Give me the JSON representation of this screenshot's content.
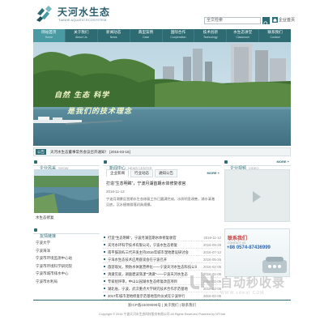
{
  "header": {
    "logo_cn": "天河水生态",
    "logo_en": "TIANHE AQUATIC ECOSYSTEM",
    "search_placeholder": "全文检索",
    "home_link": "企业首页"
  },
  "nav": [
    {
      "cn": "网站首页",
      "en": "Home",
      "active": true
    },
    {
      "cn": "关于我们",
      "en": "About Us"
    },
    {
      "cn": "新闻动态",
      "en": "News"
    },
    {
      "cn": "典型案例",
      "en": "Case"
    },
    {
      "cn": "国际合作",
      "en": "Cooperation"
    },
    {
      "cn": "技术创新",
      "en": "Technology"
    },
    {
      "cn": "水生态讲堂",
      "en": "Classroom"
    },
    {
      "cn": "联系我们",
      "en": "Contact"
    }
  ],
  "banner": {
    "line1": "自然 生态 科学",
    "line2": "是我们的技术理念"
  },
  "notice": {
    "tag": "公告",
    "text": "天河水生态董事常务会议召开通知！  [2016-03-16]"
  },
  "left_panel": {
    "title": "企业风采",
    "title_en": "SHOW",
    "photo_caption": "水生态修复"
  },
  "friend_links": {
    "title": "友情链接",
    "items": [
      "宁波大学",
      "宁波海洋",
      "宁波市环境监测中心站",
      "宁波市环境科学研究院",
      "宁波市城市排水中心",
      "宁波市水利局"
    ]
  },
  "news": {
    "title": "新闻中心",
    "title_en": "NEWS CENTER",
    "more": "MORE +",
    "tabs": [
      "企业新闻",
      "行业动态",
      "通知公告"
    ],
    "featured": {
      "title": "打造“生态明眸”，宁波月湖首期水体修复收官",
      "date": "2016-11-12",
      "body": "宁波月湖景区首期水生态修复工作已圆满完成，水质明显改善，湖水清澈见底，沉水植物群落初具规模。"
    },
    "items": [
      {
        "title": "打造“生态明眸”，宁波月湖首期水体修复收官",
        "date": "2016-11-12"
      },
      {
        "title": "天河水环科学技术有限公司，宁波水生态修复",
        "date": "2016-09-29"
      },
      {
        "title": "南平鼓浪屿三代开发主持2016年城市湿地建设研讨会",
        "date": "2016-07-12"
      },
      {
        "title": "宁海水生态技术应用座谈会在宁波召开",
        "date": "2016-05-26"
      },
      {
        "title": "旅游观光，预防水体富营养化——宁波天河水生态科技公司",
        "date": "2016-02-05"
      },
      {
        "title": "清澈见底，湖面碧波荡漾”“清澈”——宁波天河水生态",
        "date": "2016-02-05"
      },
      {
        "title": "专家组评审，中山公园湖水生态修复改造项目",
        "date": "2016-02-05"
      },
      {
        "title": "湖北省，宁波，武汉重点大学研究技术合作示范基地",
        "date": "2016-02-05"
      },
      {
        "title": "2017年城市湿地修复示范基地签约仪式在宁波举行",
        "date": "2016-02-05"
      }
    ]
  },
  "video": {
    "title": "企业视频",
    "title_en": "VIDEO",
    "more": "MORE +"
  },
  "contact": {
    "title": "联系我们",
    "en": "CONTACT US",
    "phone": "+86 0574-87436999"
  },
  "footer": {
    "links": "浙ICP备16009598号   |   关于我们   |   联系我们",
    "copyright": "Copyright © 2016 宁波天河水生态科技股份有限公司 All Rights Reserved Powered by NTHub"
  },
  "watermark": {
    "text": "自动秒收录",
    "sub": "WWW.zdmsl.COM"
  }
}
